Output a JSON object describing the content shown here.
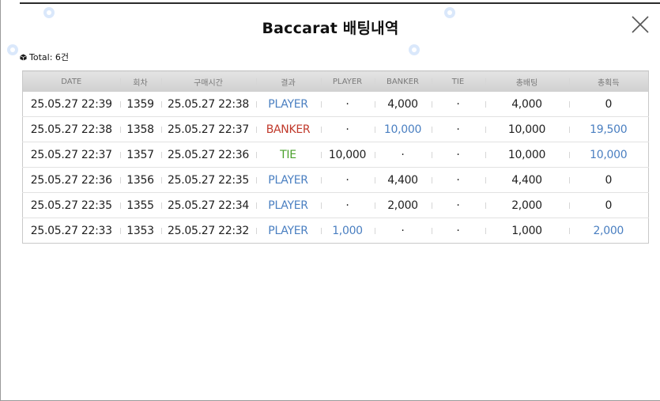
{
  "window": {
    "title": "Baccarat 배팅내역",
    "total_label": "Total: 6건"
  },
  "colors": {
    "player": "#4a7fc1",
    "banker": "#c0392b",
    "tie": "#4aa02c",
    "highlight": "#4a7fc1"
  },
  "icons": {
    "close": "close-icon",
    "total": "cube-icon"
  },
  "table": {
    "columns": [
      "DATE",
      "회차",
      "구매시간",
      "결과",
      "PLAYER",
      "BANKER",
      "TIE",
      "총배팅",
      "총획득"
    ],
    "rows": [
      {
        "date": "25.05.27 22:39",
        "round": "1359",
        "purchase": "25.05.27 22:38",
        "result": "PLAYER",
        "result_type": "player",
        "player": "·",
        "banker": "4,000",
        "tie": "·",
        "total_bet": "4,000",
        "total_win": "0",
        "player_hl": false,
        "banker_hl": false,
        "win_hl": false
      },
      {
        "date": "25.05.27 22:38",
        "round": "1358",
        "purchase": "25.05.27 22:37",
        "result": "BANKER",
        "result_type": "banker",
        "player": "·",
        "banker": "10,000",
        "tie": "·",
        "total_bet": "10,000",
        "total_win": "19,500",
        "player_hl": false,
        "banker_hl": true,
        "win_hl": true
      },
      {
        "date": "25.05.27 22:37",
        "round": "1357",
        "purchase": "25.05.27 22:36",
        "result": "TIE",
        "result_type": "tie",
        "player": "10,000",
        "banker": "·",
        "tie": "·",
        "total_bet": "10,000",
        "total_win": "10,000",
        "player_hl": false,
        "banker_hl": false,
        "win_hl": true
      },
      {
        "date": "25.05.27 22:36",
        "round": "1356",
        "purchase": "25.05.27 22:35",
        "result": "PLAYER",
        "result_type": "player",
        "player": "·",
        "banker": "4,400",
        "tie": "·",
        "total_bet": "4,400",
        "total_win": "0",
        "player_hl": false,
        "banker_hl": false,
        "win_hl": false
      },
      {
        "date": "25.05.27 22:35",
        "round": "1355",
        "purchase": "25.05.27 22:34",
        "result": "PLAYER",
        "result_type": "player",
        "player": "·",
        "banker": "2,000",
        "tie": "·",
        "total_bet": "2,000",
        "total_win": "0",
        "player_hl": false,
        "banker_hl": false,
        "win_hl": false
      },
      {
        "date": "25.05.27 22:33",
        "round": "1353",
        "purchase": "25.05.27 22:32",
        "result": "PLAYER",
        "result_type": "player",
        "player": "1,000",
        "banker": "·",
        "tie": "·",
        "total_bet": "1,000",
        "total_win": "2,000",
        "player_hl": true,
        "banker_hl": false,
        "win_hl": true
      }
    ]
  }
}
